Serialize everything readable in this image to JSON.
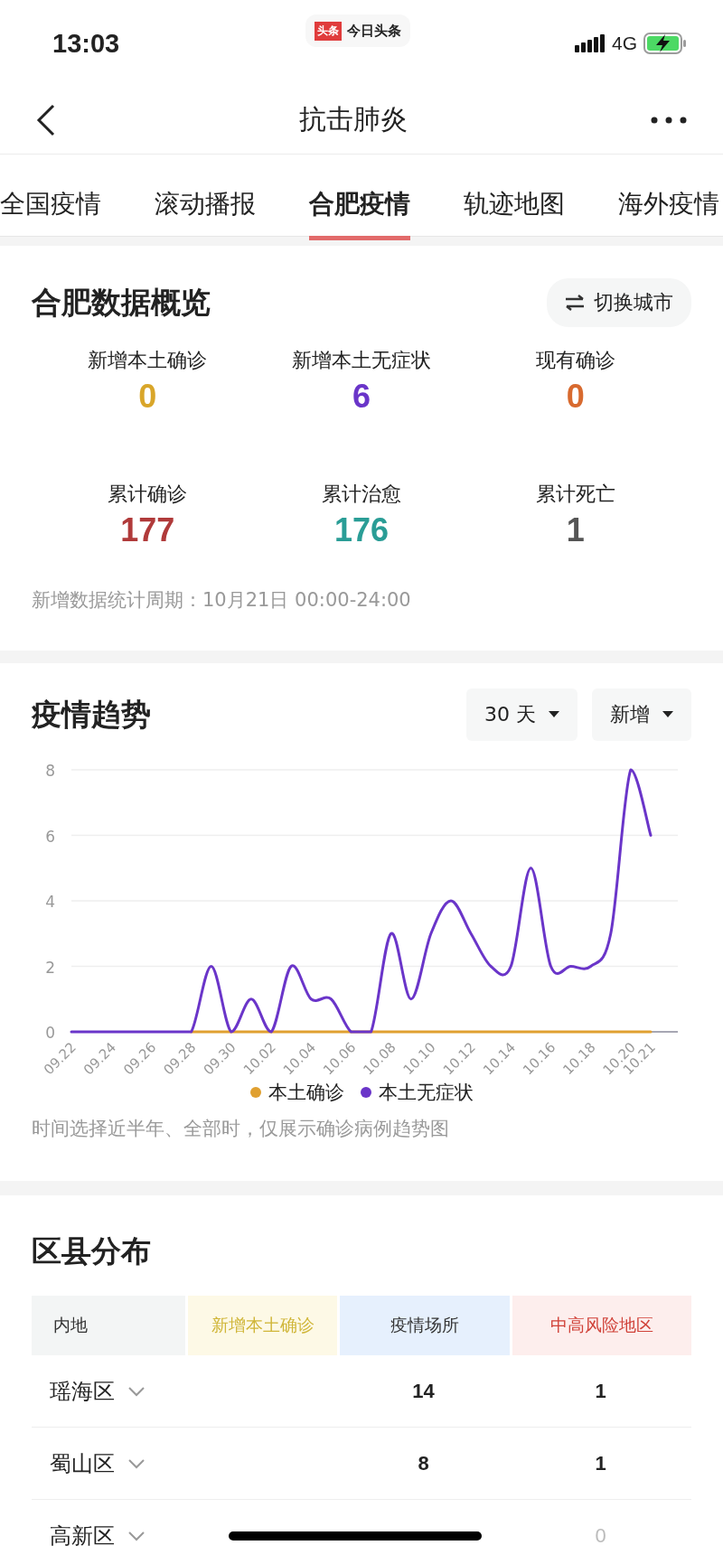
{
  "status_bar": {
    "time": "13:03",
    "source_app": {
      "badge": "头条",
      "name": "今日头条"
    },
    "network": "4G"
  },
  "nav": {
    "title": "抗击肺炎"
  },
  "tabs": [
    {
      "label": "全国疫情",
      "selected": false
    },
    {
      "label": "滚动播报",
      "selected": false
    },
    {
      "label": "合肥疫情",
      "selected": true
    },
    {
      "label": "轨迹地图",
      "selected": false
    },
    {
      "label": "海外疫情",
      "selected": false
    }
  ],
  "overview": {
    "title": "合肥数据概览",
    "switch_button": "切换城市",
    "stats": [
      {
        "label": "新增本土确诊",
        "value": "0",
        "color": "#d9a62a"
      },
      {
        "label": "新增本土无症状",
        "value": "6",
        "color": "#6a35c9"
      },
      {
        "label": "现有确诊",
        "value": "0",
        "color": "#d86a2f"
      },
      {
        "label": "累计确诊",
        "value": "177",
        "color": "#b03a3a"
      },
      {
        "label": "累计治愈",
        "value": "176",
        "color": "#2a9d96"
      },
      {
        "label": "累计死亡",
        "value": "1",
        "color": "#555555"
      }
    ],
    "note": "新增数据统计周期：10月21日 00:00-24:00"
  },
  "trend": {
    "title": "疫情趋势",
    "filters": [
      {
        "label": "30 天"
      },
      {
        "label": "新增"
      }
    ],
    "chart_data": {
      "type": "line",
      "categories": [
        "09.22",
        null,
        "09.24",
        null,
        "09.26",
        null,
        "09.28",
        null,
        "09.30",
        null,
        "10.02",
        null,
        "10.04",
        null,
        "10.06",
        null,
        "10.08",
        null,
        "10.10",
        null,
        "10.12",
        null,
        "10.14",
        null,
        "10.16",
        null,
        "10.18",
        null,
        "10.20",
        "10.21"
      ],
      "ylim": [
        0,
        8
      ],
      "yticks": [
        0,
        2,
        4,
        6,
        8
      ],
      "grid": true,
      "series": [
        {
          "name": "本土确诊",
          "color": "#e0a030",
          "values": [
            null,
            null,
            null,
            null,
            null,
            null,
            0,
            0,
            0,
            0,
            0,
            0,
            0,
            0,
            0,
            0,
            0,
            0,
            0,
            0,
            0,
            0,
            0,
            0,
            0,
            0,
            0,
            0,
            0,
            0
          ]
        },
        {
          "name": "本土无症状",
          "color": "#6a35c9",
          "values": [
            0,
            0,
            0,
            0,
            0,
            0,
            0,
            2,
            0,
            1,
            0,
            2,
            1,
            1,
            0,
            0,
            3,
            1,
            3,
            4,
            3,
            2,
            2,
            5,
            2,
            2,
            2,
            3,
            8,
            6
          ]
        }
      ]
    },
    "note": "时间选择近半年、全部时，仅展示确诊病例趋势图"
  },
  "districts": {
    "title": "区县分布",
    "columns": [
      {
        "label": "内地",
        "color": "#f3f5f5",
        "tinted_text": false
      },
      {
        "label": "新增本土确诊",
        "color": "#fdf9e6",
        "tinted_text": true
      },
      {
        "label": "疫情场所",
        "color": "#e6f0fd",
        "tinted_text": false
      },
      {
        "label": "中高风险地区",
        "color": "#fdeeed",
        "tinted_text": true
      }
    ],
    "rows": [
      {
        "district": "瑶海区",
        "expanded": false,
        "places": "14",
        "risk_areas": "1",
        "risk_dim": false
      },
      {
        "district": "蜀山区",
        "expanded": false,
        "places": "8",
        "risk_areas": "1",
        "risk_dim": false
      },
      {
        "district": "高新区",
        "expanded": false,
        "risk_areas": "0",
        "risk_dim": true
      }
    ]
  }
}
